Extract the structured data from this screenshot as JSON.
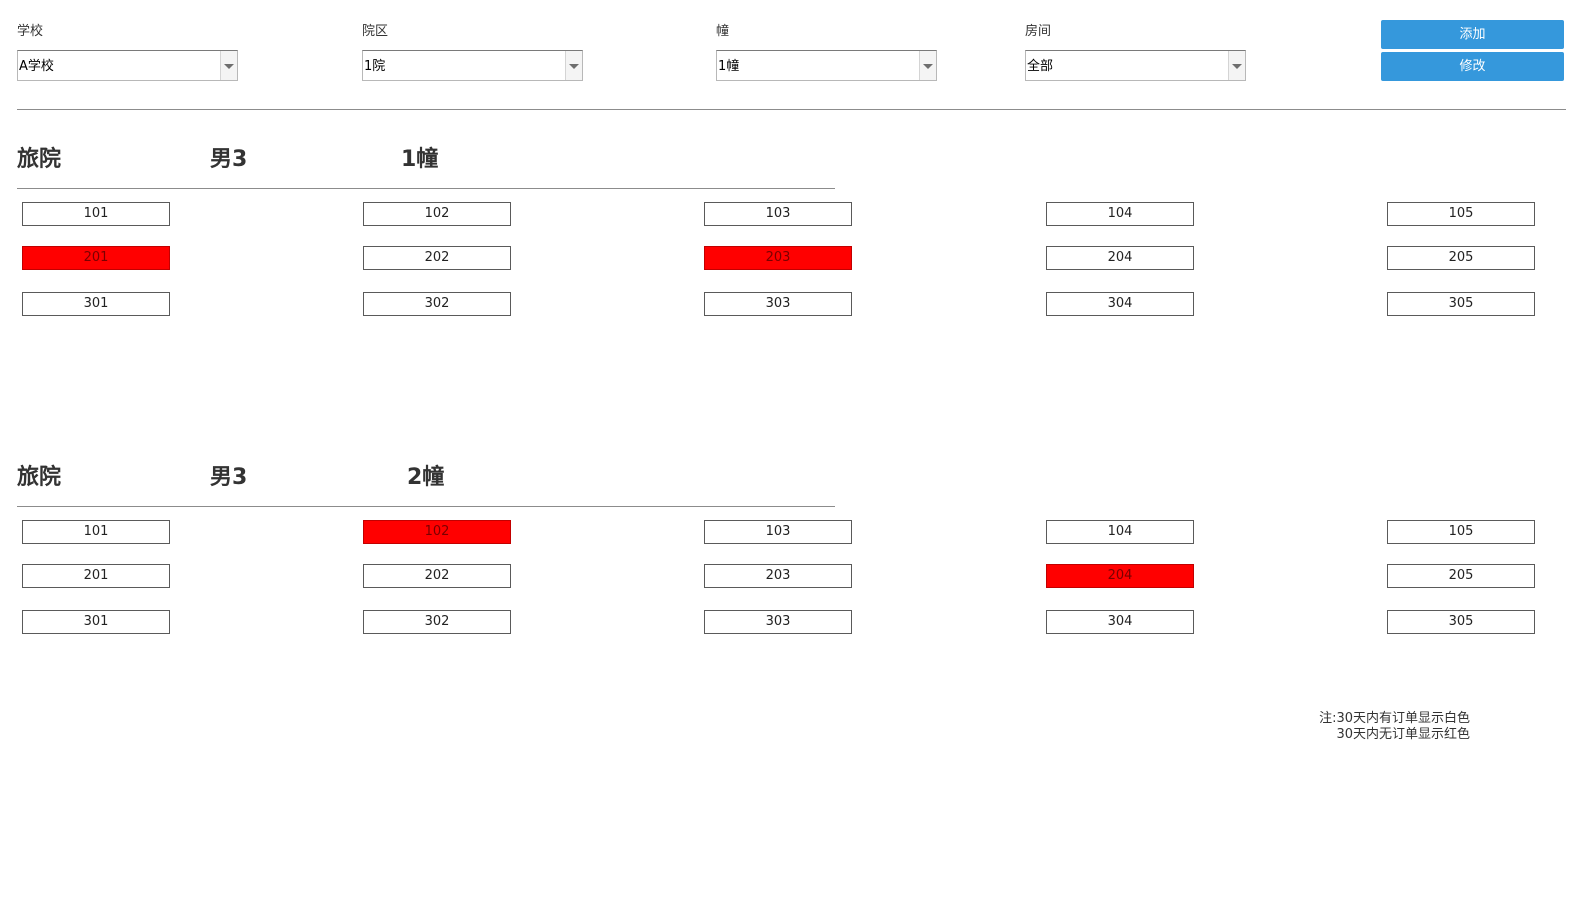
{
  "filters": {
    "school": {
      "label": "学校",
      "value": "A学校"
    },
    "campus": {
      "label": "院区",
      "value": "1院"
    },
    "building": {
      "label": "幢",
      "value": "1幢"
    },
    "room": {
      "label": "房间",
      "value": "全部"
    }
  },
  "actions": {
    "add_label": "添加",
    "edit_label": "修改"
  },
  "colors": {
    "button": "#3598dc",
    "no_order": "#ff0000",
    "has_order": "#ffffff"
  },
  "sections": [
    {
      "type": "旅院",
      "gender": "男3",
      "building": "1幢",
      "rows": [
        [
          {
            "number": "101",
            "no_order": false
          },
          {
            "number": "102",
            "no_order": false
          },
          {
            "number": "103",
            "no_order": false
          },
          {
            "number": "104",
            "no_order": false
          },
          {
            "number": "105",
            "no_order": false
          }
        ],
        [
          {
            "number": "201",
            "no_order": true
          },
          {
            "number": "202",
            "no_order": false
          },
          {
            "number": "203",
            "no_order": true
          },
          {
            "number": "204",
            "no_order": false
          },
          {
            "number": "205",
            "no_order": false
          }
        ],
        [
          {
            "number": "301",
            "no_order": false
          },
          {
            "number": "302",
            "no_order": false
          },
          {
            "number": "303",
            "no_order": false
          },
          {
            "number": "304",
            "no_order": false
          },
          {
            "number": "305",
            "no_order": false
          }
        ]
      ]
    },
    {
      "type": "旅院",
      "gender": "男3",
      "building": "2幢",
      "rows": [
        [
          {
            "number": "101",
            "no_order": false
          },
          {
            "number": "102",
            "no_order": true
          },
          {
            "number": "103",
            "no_order": false
          },
          {
            "number": "104",
            "no_order": false
          },
          {
            "number": "105",
            "no_order": false
          }
        ],
        [
          {
            "number": "201",
            "no_order": false
          },
          {
            "number": "202",
            "no_order": false
          },
          {
            "number": "203",
            "no_order": false
          },
          {
            "number": "204",
            "no_order": true
          },
          {
            "number": "205",
            "no_order": false
          }
        ],
        [
          {
            "number": "301",
            "no_order": false
          },
          {
            "number": "302",
            "no_order": false
          },
          {
            "number": "303",
            "no_order": false
          },
          {
            "number": "304",
            "no_order": false
          },
          {
            "number": "305",
            "no_order": false
          }
        ]
      ]
    }
  ],
  "note": {
    "line1": "注:30天内有订单显示白色",
    "line2": "30天内无订单显示红色"
  }
}
